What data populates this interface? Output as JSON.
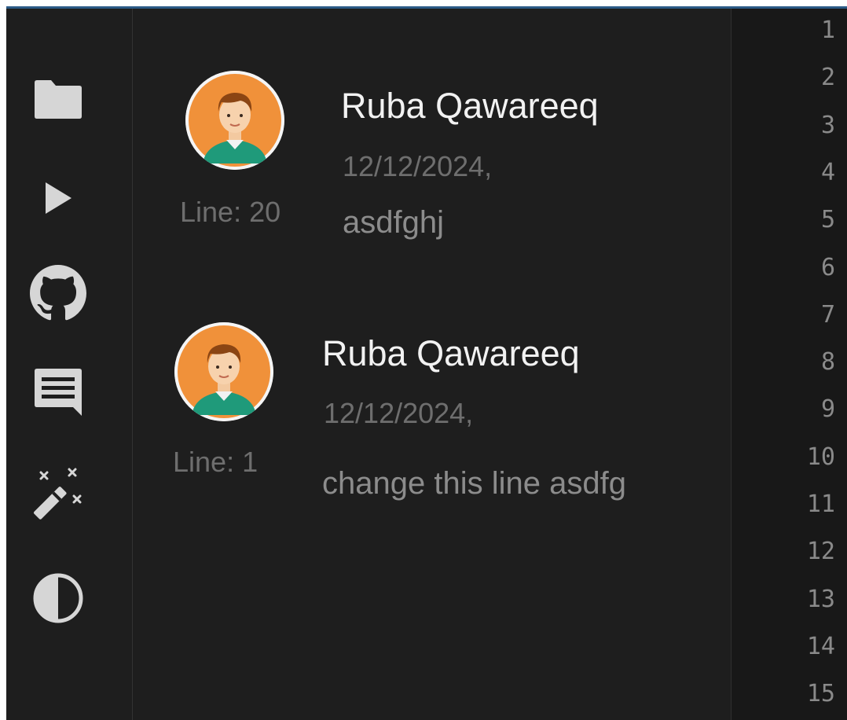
{
  "activity_bar": {
    "icons": [
      "folder-icon",
      "run-icon",
      "github-icon",
      "comments-icon",
      "magic-wand-icon",
      "theme-contrast-icon"
    ]
  },
  "comments": [
    {
      "author": "Ruba Qawareeq",
      "date": "12/12/2024,",
      "line_label": "Line: 20",
      "text": "asdfghj"
    },
    {
      "author": "Ruba Qawareeq",
      "date": "12/12/2024,",
      "line_label": "Line: 1",
      "text": "change this line asdfg"
    }
  ],
  "gutter": {
    "line_numbers": [
      "1",
      "2",
      "3",
      "4",
      "5",
      "6",
      "7",
      "8",
      "9",
      "10",
      "11",
      "12",
      "13",
      "14",
      "15"
    ]
  },
  "colors": {
    "background": "#1e1e1e",
    "gutter_background": "#181818",
    "avatar_orange": "#f0913a",
    "avatar_shirt": "#1f9a7a"
  }
}
